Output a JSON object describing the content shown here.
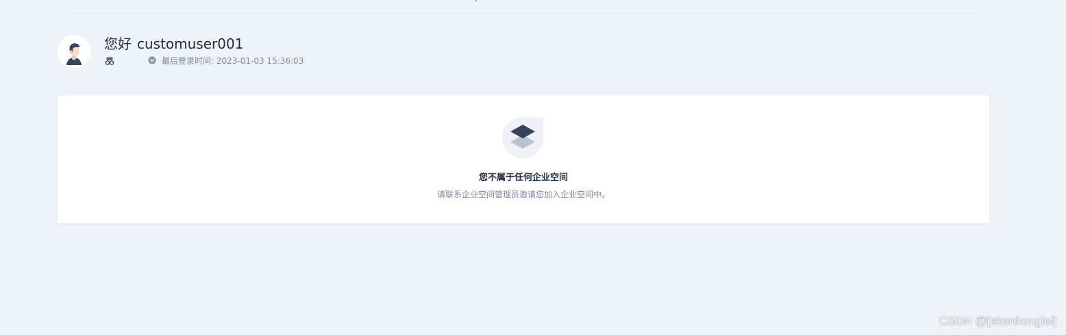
{
  "header": {
    "greeting_prefix": "您好",
    "username": "customuser001",
    "last_login_label": "最后登录时间:",
    "last_login_time": "2023-01-03 15:36:03"
  },
  "empty_state": {
    "title": "您不属于任何企业空间",
    "description": "请联系企业空间管理员邀请您加入企业空间中。"
  },
  "watermark": {
    "text": "CSDN @[shenhonglei]"
  },
  "icons": {
    "avatar": "user-avatar",
    "role": "glasses-icon",
    "clock": "clock-icon",
    "empty": "layers-icon"
  },
  "colors": {
    "page_background": "#eef3f8",
    "card_background": "#ffffff",
    "title_text": "#1f2d3d",
    "muted_text": "#7c8a99",
    "icon_dark": "#36435c",
    "icon_light": "#b6c2cf"
  }
}
